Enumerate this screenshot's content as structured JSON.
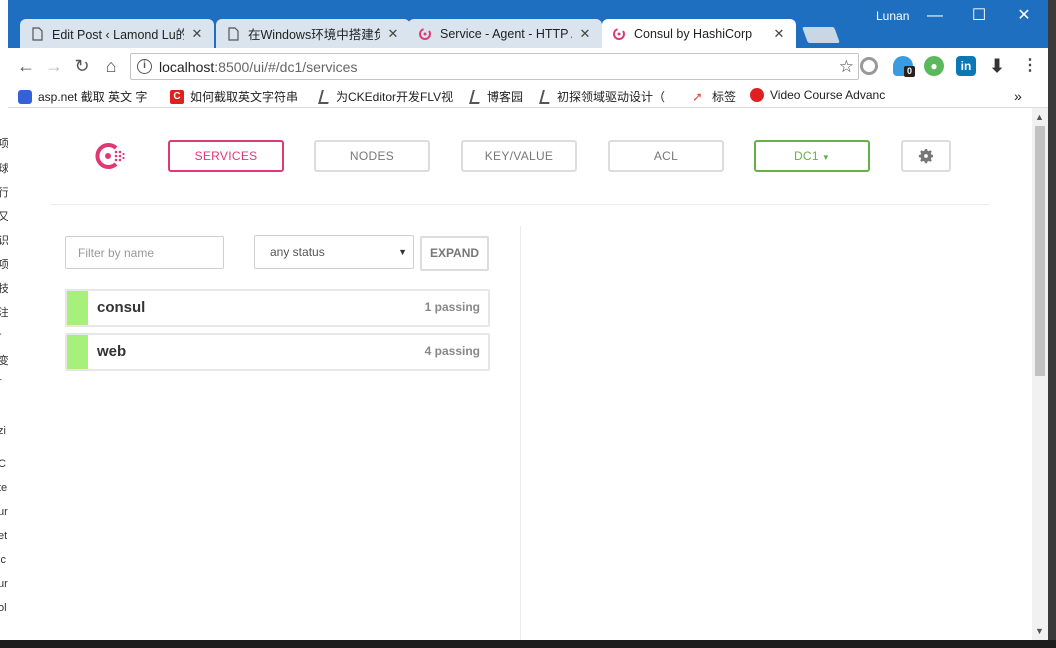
{
  "desktop": {
    "fragments": [
      "项",
      "球",
      "行",
      "又",
      "识",
      "项",
      "技",
      "注",
      "-",
      "变",
      "r",
      "zi",
      "C",
      "te",
      "ur",
      "et",
      "ic",
      "ur",
      "ol",
      "l"
    ]
  },
  "window": {
    "user": "Lunan"
  },
  "tabs": [
    {
      "title": "Edit Post ‹ Lamond Lu的",
      "favicon": "document-icon"
    },
    {
      "title": "在Windows环境中搭建负",
      "favicon": "document-icon"
    },
    {
      "title": "Service - Agent - HTTP A",
      "favicon": "consul-icon"
    },
    {
      "title": "Consul by HashiCorp",
      "favicon": "consul-icon",
      "active": true
    }
  ],
  "address": {
    "host": "localhost",
    "path": ":8500/ui/#/dc1/services"
  },
  "extensions": {
    "ghost_badge": "0"
  },
  "bookmarks": [
    {
      "label": "asp.net 截取 英文 字",
      "icon": "baidu-icon"
    },
    {
      "label": "如何截取英文字符串",
      "icon": "c-icon"
    },
    {
      "label": "为CKEditor开发FLV视",
      "icon": "cnblogs-icon"
    },
    {
      "label": "博客园",
      "icon": "cnblogs-icon"
    },
    {
      "label": "初探领域驱动设计（",
      "icon": "cnblogs-icon"
    },
    {
      "label": "标签",
      "icon": "tag-icon"
    },
    {
      "label": "Video Course Advanc",
      "icon": "video-icon"
    }
  ],
  "consul": {
    "nav": {
      "services": "SERVICES",
      "nodes": "NODES",
      "keyvalue": "KEY/VALUE",
      "acl": "ACL",
      "dc": "DC1"
    },
    "filter": {
      "placeholder": "Filter by name"
    },
    "status": {
      "selected": "any status"
    },
    "expand": "EXPAND",
    "services": [
      {
        "name": "consul",
        "status": "1 passing"
      },
      {
        "name": "web",
        "status": "4 passing"
      }
    ],
    "colors": {
      "brand": "#e03875",
      "dc": "#67b046",
      "passing": "#a8f07c"
    }
  }
}
